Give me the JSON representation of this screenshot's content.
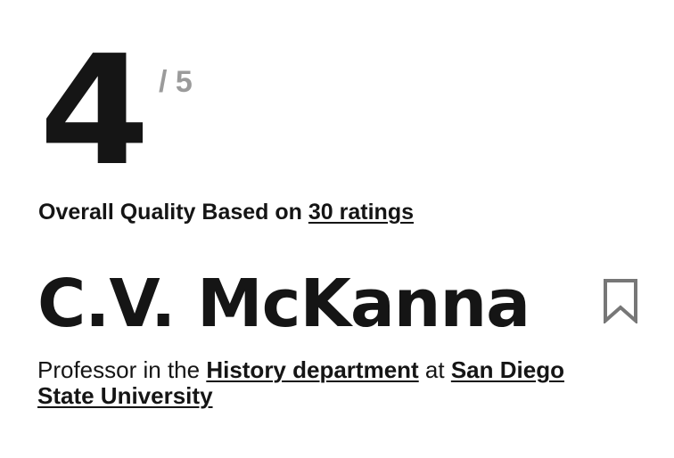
{
  "rating": {
    "value": "4",
    "max_label": "/ 5"
  },
  "quality": {
    "prefix": "Overall Quality Based on ",
    "ratings_link": "30 ratings"
  },
  "professor": {
    "name": "C.V. McKanna"
  },
  "department": {
    "prefix": "Professor in the ",
    "department_link": "History department",
    "middle": " at ",
    "school_link": "San Diego State University"
  },
  "icons": {
    "bookmark": "bookmark-icon"
  },
  "colors": {
    "text": "#151515",
    "muted": "#9b9b9b",
    "background": "#ffffff"
  }
}
